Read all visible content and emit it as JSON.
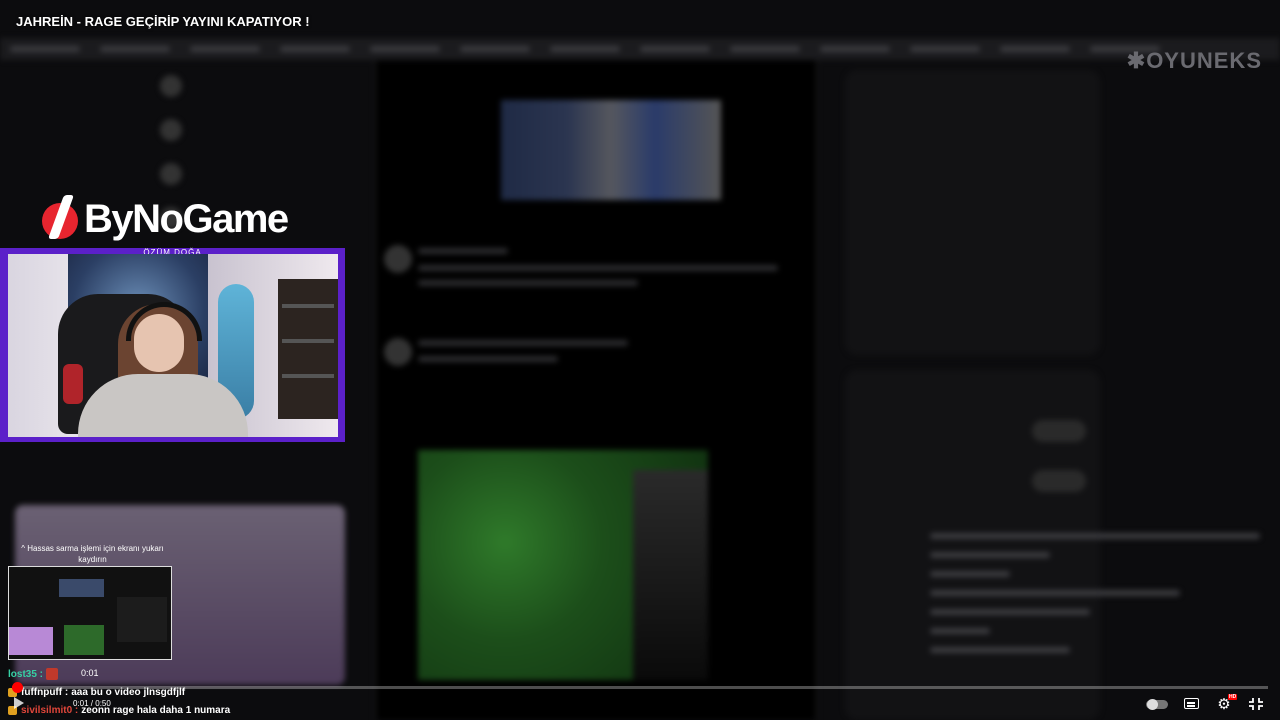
{
  "video": {
    "title": "JAHREİN - RAGE GEÇİRİP YAYINI KAPATIYOR !",
    "time_current": "0:01",
    "time_display": "0:01 / 0:50",
    "progress": 0.004
  },
  "logo": {
    "text": "ByNoGame",
    "streamer": "ÖZÜM DOĞA"
  },
  "notice": {
    "text": "Hassas sarma işlemi için ekranı yukarı kaydırın"
  },
  "chat": [
    {
      "user": "lost35 :",
      "message": "",
      "user_color": "#36d1a5",
      "badge_color": "#c0392b"
    },
    {
      "user": "fuffnpuff :",
      "message": "aaa bu o video jlnsgdfjlf",
      "user_color": "#ffffff",
      "badge_color": "#e0a020"
    },
    {
      "user": "sivilsilmit0 :",
      "message": "zeonn rage hala daha 1 numara",
      "user_color": "#e0463a",
      "badge_color": "#e0a020"
    }
  ],
  "colors": {
    "accent": "#ff0000",
    "webcam_frame": "#5b20c9",
    "logo_red": "#e7252f"
  },
  "icons": [
    "play-icon",
    "autoplay-toggle-icon",
    "subtitles-icon",
    "settings-icon",
    "exit-fullscreen-icon"
  ]
}
